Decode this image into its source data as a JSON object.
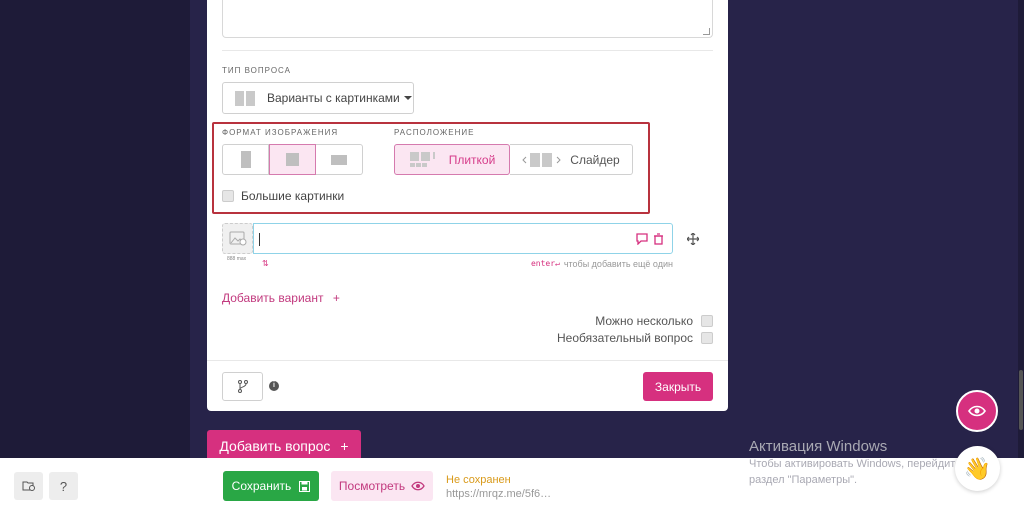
{
  "question": {
    "type_label": "ТИП ВОПРОСА",
    "type_value": "Варианты с картинками",
    "format_label": "ФОРМАТ ИЗОБРАЖЕНИЯ",
    "layout_label": "РАСПОЛОЖЕНИЕ",
    "layout_tile": "Плиткой",
    "layout_slider": "Слайдер",
    "big_pictures_label": "Большие картинки",
    "image_size_hint": "888 max",
    "enter_hint_key": "enter↵",
    "enter_hint_text": "чтобы добавить ещё один",
    "add_variant": "Добавить вариант",
    "multiple_label": "Можно несколько",
    "optional_label": "Необязательный вопрос",
    "close_button": "Закрыть"
  },
  "add_question": "Добавить вопрос",
  "bottom_bar": {
    "help": "?",
    "save": "Сохранить",
    "preview": "Посмотреть",
    "status": "Не сохранен",
    "link": "https://mrqz.me/5f6…"
  },
  "watermark": {
    "title": "Активация Windows",
    "line1": "Чтобы активировать Windows, перейдите в",
    "line2": "раздел \"Параметры\"."
  },
  "colors": {
    "accent": "#d6307f",
    "success": "#29a745",
    "background": "#1e1b38",
    "highlight_border": "#b8323e",
    "status_warning": "#d99a1a"
  }
}
